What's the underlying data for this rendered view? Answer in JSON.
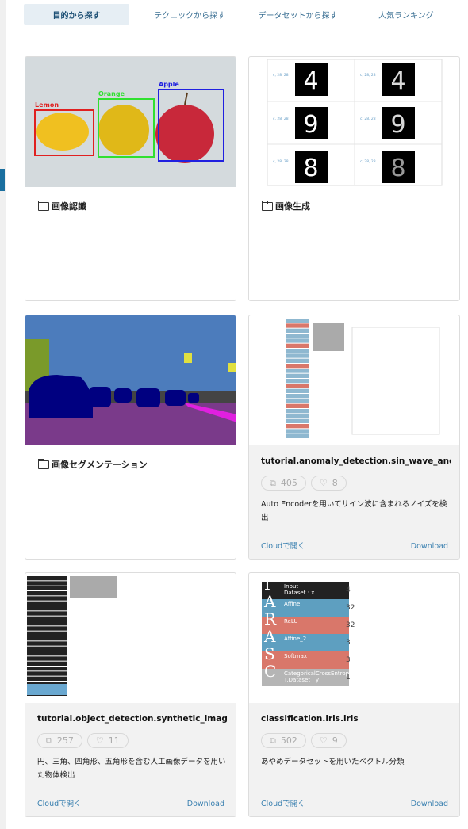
{
  "tabs": [
    {
      "label": "目的から探す",
      "active": true
    },
    {
      "label": "テクニックから探す"
    },
    {
      "label": "データセットから探す"
    },
    {
      "label": "人気ランキング"
    }
  ],
  "cards": [
    {
      "type": "folder",
      "title": "画像認識",
      "image": {
        "labels": [
          "Lemon",
          "Orange",
          "Apple"
        ],
        "colors": [
          "#e02020",
          "#30e030",
          "#2020e0"
        ]
      }
    },
    {
      "type": "folder",
      "title": "画像生成",
      "image": {
        "shape_label": "c, 28, 28",
        "digits": [
          "4",
          "9",
          "8"
        ]
      }
    },
    {
      "type": "folder",
      "title": "画像セグメンテーション"
    },
    {
      "type": "project",
      "title": "tutorial.anomaly_detection.sin_wave_anomal...",
      "copies": "405",
      "likes": "8",
      "description": "Auto Encoderを用いてサイン波に含まれるノイズを検出",
      "cloud": "Cloudで開く",
      "download": "Download"
    },
    {
      "type": "project",
      "title": "tutorial.object_detection.synthetic_image_obj...",
      "copies": "257",
      "likes": "11",
      "description": "円、三角、四角形、五角形を含む人工画像データを用いた物体検出",
      "cloud": "Cloudで開く",
      "download": "Download"
    },
    {
      "type": "project",
      "title": "classification.iris.iris",
      "copies": "502",
      "likes": "9",
      "description": "あやめデータセットを用いたベクトル分類",
      "cloud": "Cloudで開く",
      "download": "Download",
      "network": [
        {
          "letter": "I",
          "name": "Input",
          "sub": "Dataset : x",
          "color": "#222222",
          "out": "4"
        },
        {
          "letter": "A",
          "name": "Affine",
          "color": "#5e9fc0",
          "out": "32"
        },
        {
          "letter": "R",
          "name": "ReLU",
          "color": "#d9776a",
          "out": "32"
        },
        {
          "letter": "A",
          "name": "Affine_2",
          "color": "#5e9fc0",
          "out": "3"
        },
        {
          "letter": "S",
          "name": "Softmax",
          "color": "#d9776a",
          "out": "3"
        },
        {
          "letter": "C",
          "name": "CategoricalCrossEntropy",
          "sub": "T.Dataset : y",
          "color": "#b5b5b5",
          "out": "1"
        }
      ]
    }
  ]
}
